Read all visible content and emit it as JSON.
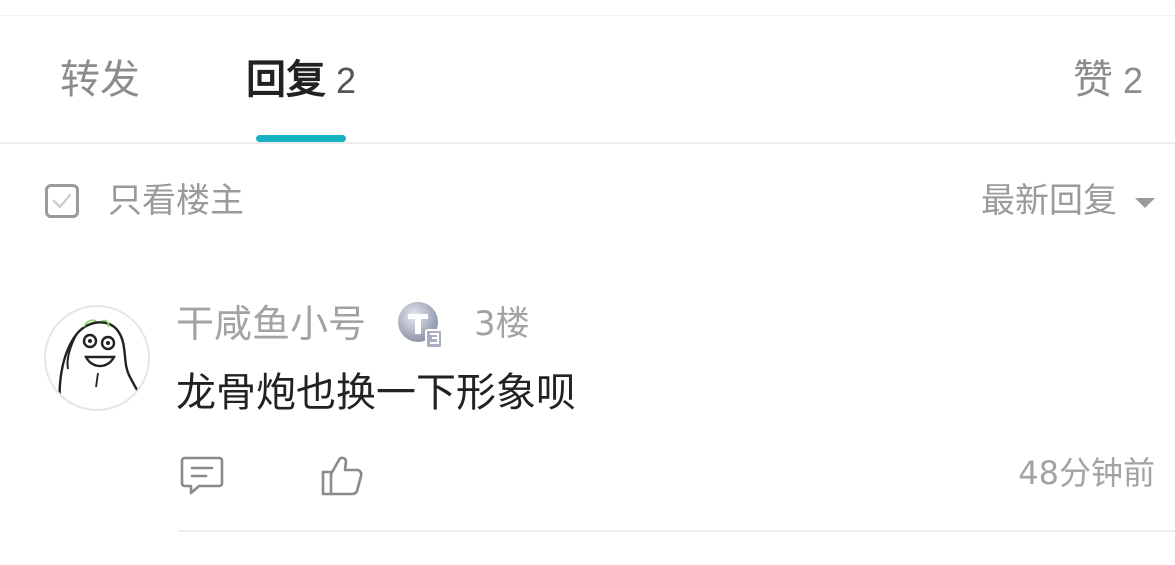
{
  "tabs": [
    {
      "label": "转发",
      "count": ""
    },
    {
      "label": "回复",
      "count": "2"
    },
    {
      "label": "赞",
      "count": "2"
    }
  ],
  "filter": {
    "only_owner_label": "只看楼主",
    "only_owner_checked": false,
    "sort_label": "最新回复"
  },
  "colors": {
    "accent": "#17b2c2",
    "muted_text": "#9a9a9a",
    "primary_text": "#222222"
  },
  "reply": {
    "username": "干咸鱼小号",
    "badge_icon": "level-t3-badge-icon",
    "floor": "3楼",
    "content": "龙骨炮也换一下形象呗",
    "time": "48分钟前"
  }
}
